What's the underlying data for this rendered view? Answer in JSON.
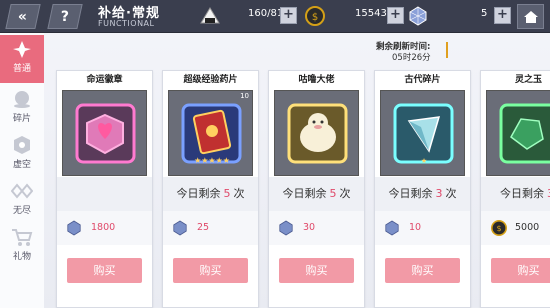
{
  "header": {
    "title": "补给·常规",
    "subtitle": "FUNCTIONAL",
    "stamina": "160/81",
    "gold": "15543",
    "gems": "5"
  },
  "sidebar": {
    "items": [
      {
        "label": "普通"
      },
      {
        "label": "碎片"
      },
      {
        "label": "虚空"
      },
      {
        "label": "无尽"
      },
      {
        "label": "礼物"
      }
    ]
  },
  "refresh": {
    "label": "剩余刷新时间:",
    "time": "05时26分"
  },
  "cards": [
    {
      "name": "命运徽章",
      "quantity": "",
      "limit_prefix": "",
      "limit_count": "",
      "limit_suffix": "",
      "price": "1800",
      "currency": "crystal-icon",
      "buy": "购买"
    },
    {
      "name": "超级经验药片",
      "quantity": "10",
      "limit_prefix": "今日剩余",
      "limit_count": "5",
      "limit_suffix": "次",
      "price": "25",
      "currency": "crystal-icon",
      "buy": "购买"
    },
    {
      "name": "咕噜大佬",
      "quantity": "",
      "limit_prefix": "今日剩余",
      "limit_count": "5",
      "limit_suffix": "次",
      "price": "30",
      "currency": "crystal-icon",
      "buy": "购买"
    },
    {
      "name": "古代碎片",
      "quantity": "",
      "limit_prefix": "今日剩余",
      "limit_count": "3",
      "limit_suffix": "次",
      "price": "10",
      "currency": "crystal-icon",
      "buy": "购买"
    },
    {
      "name": "灵之玉",
      "quantity": "",
      "limit_prefix": "今日剩余",
      "limit_count": "3",
      "limit_suffix": "",
      "price": "5000",
      "currency": "gold-coin-icon",
      "buy": "购买"
    }
  ],
  "colors": {
    "accent": "#e96b7e",
    "buy_button": "#f29aa6",
    "count": "#e04a6a",
    "topbar": "#3a3e4e"
  }
}
